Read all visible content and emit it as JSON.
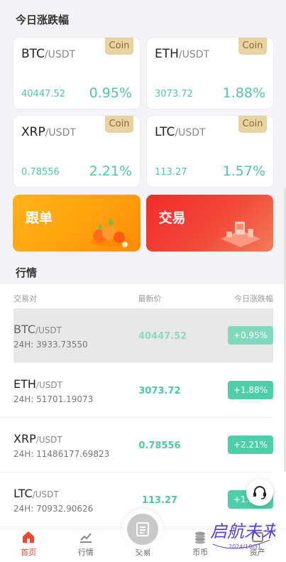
{
  "today": {
    "title": "今日涨跌幅",
    "cards": [
      {
        "base": "BTC",
        "quote": "/USDT",
        "tag": "Coin",
        "price": "40447.52",
        "pct": "0.95%"
      },
      {
        "base": "ETH",
        "quote": "/USDT",
        "tag": "Coin",
        "price": "3073.72",
        "pct": "1.88%"
      },
      {
        "base": "XRP",
        "quote": "/USDT",
        "tag": "Coin",
        "price": "0.78556",
        "pct": "2.21%"
      },
      {
        "base": "LTC",
        "quote": "/USDT",
        "tag": "Coin",
        "price": "113.27",
        "pct": "1.57%"
      }
    ]
  },
  "banners": {
    "follow": "跟单",
    "trade": "交易"
  },
  "market": {
    "title": "行情",
    "columns": [
      "交易对",
      "最新价",
      "今日涨跌幅"
    ],
    "rows": [
      {
        "base": "BTC",
        "quote": "/USDT",
        "vol": "24H: 3933.73550",
        "last": "40447.52",
        "chg": "+0.95%"
      },
      {
        "base": "ETH",
        "quote": "/USDT",
        "vol": "24H: 51701.19073",
        "last": "3073.72",
        "chg": "+1.88%"
      },
      {
        "base": "XRP",
        "quote": "/USDT",
        "vol": "24H: 11486177.69823",
        "last": "0.78556",
        "chg": "+2.21%"
      },
      {
        "base": "LTC",
        "quote": "/USDT",
        "vol": "24H: 70932.90626",
        "last": "113.27",
        "chg": "+1.57%"
      }
    ]
  },
  "tabbar": {
    "home": "首页",
    "market": "行情",
    "trade": "交易",
    "coins": "币币",
    "assets": "资产"
  },
  "watermark": {
    "text": "启航未来",
    "sub": "2024/10/31"
  },
  "colors": {
    "accent_green": "#4fc7a2",
    "active_tab": "#f0462a",
    "coin_tag": "#e9d3a3"
  },
  "icons": {
    "home": "home-icon",
    "market": "chart-icon",
    "trade": "trade-icon",
    "coins": "coins-icon",
    "assets": "assets-icon",
    "support": "headset-icon"
  }
}
